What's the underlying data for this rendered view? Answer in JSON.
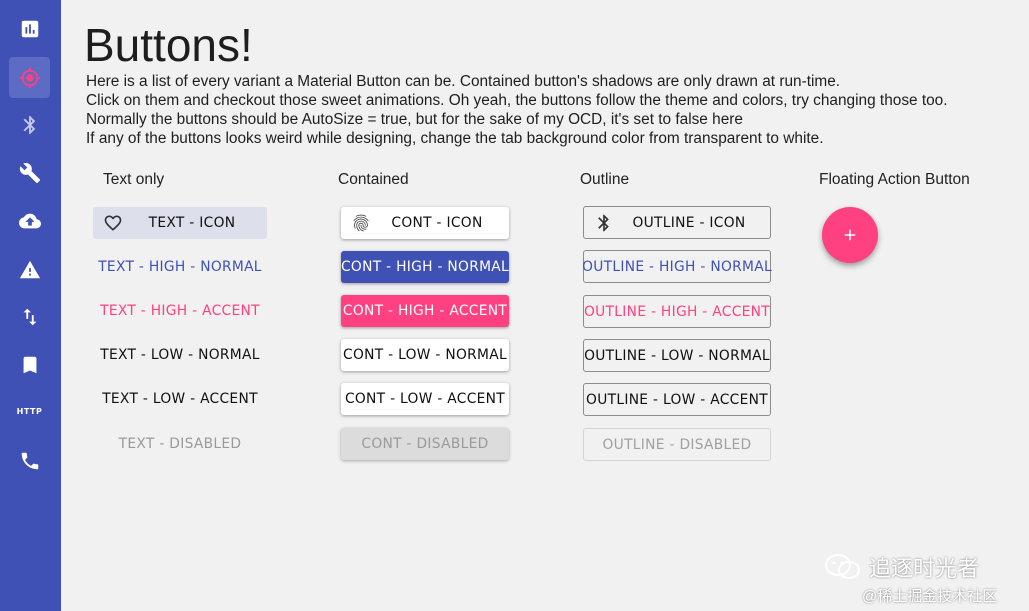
{
  "colors": {
    "primary": "#3f51b5",
    "accent": "#ff4081",
    "background": "#f1f1f1"
  },
  "sidebar": {
    "items": [
      {
        "icon": "bar-chart-icon",
        "active": false
      },
      {
        "icon": "crosshair-icon",
        "active": true
      },
      {
        "icon": "bluetooth-icon",
        "active": false
      },
      {
        "icon": "wrench-icon",
        "active": false
      },
      {
        "icon": "cloud-upload-icon",
        "active": false
      },
      {
        "icon": "warning-icon",
        "active": false
      },
      {
        "icon": "swap-vertical-icon",
        "active": false
      },
      {
        "icon": "bookmark-icon",
        "active": false
      },
      {
        "icon": "http-icon",
        "label": "HTTP",
        "active": false
      },
      {
        "icon": "phone-icon",
        "active": false
      }
    ]
  },
  "page": {
    "title": "Buttons!",
    "description": [
      "Here is a list of every variant a Material Button can be. Contained button's shadows are only drawn at run-time.",
      "Click on them and checkout those sweet animations. Oh yeah, the buttons follow the theme and colors, try changing those too.",
      "Normally the buttons should be AutoSize = true, but for the sake of my OCD, it's set to false here",
      "If any of the buttons looks weird while designing, change the tab background color from transparent to white."
    ]
  },
  "columns": {
    "text": {
      "header": "Text only",
      "buttons": [
        "TEXT - ICON",
        "TEXT - HIGH - NORMAL",
        "TEXT - HIGH - ACCENT",
        "TEXT - LOW - NORMAL",
        "TEXT - LOW - ACCENT",
        "TEXT - DISABLED"
      ],
      "icon": "heart-outline-icon"
    },
    "contained": {
      "header": "Contained",
      "buttons": [
        "CONT - ICON",
        "CONT - HIGH - NORMAL",
        "CONT - HIGH - ACCENT",
        "CONT - LOW - NORMAL",
        "CONT - LOW - ACCENT",
        "CONT - DISABLED"
      ],
      "icon": "fingerprint-icon"
    },
    "outline": {
      "header": "Outline",
      "buttons": [
        "OUTLINE - ICON",
        "OUTLINE - HIGH - NORMAL",
        "OUTLINE - HIGH - ACCENT",
        "OUTLINE - LOW - NORMAL",
        "OUTLINE - LOW - ACCENT",
        "OUTLINE - DISABLED"
      ],
      "icon": "bluetooth-icon"
    },
    "fab": {
      "header": "Floating Action Button",
      "icon": "plus-icon"
    }
  },
  "watermark": {
    "line1": "追逐时光者",
    "line2": "@稀土掘金技术社区",
    "icon": "wechat-icon"
  }
}
